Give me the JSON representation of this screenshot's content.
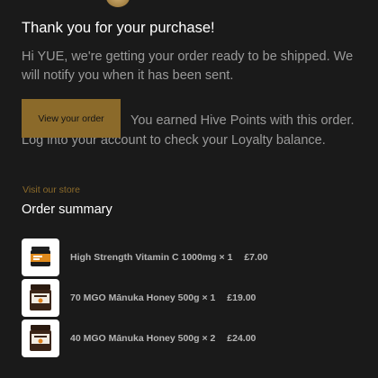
{
  "email": {
    "heading": "Thank you for your purchase!",
    "greeting": "Hi YUE, we're getting your order ready to be shipped. We will notify you when it has been sent.",
    "view_order_button": "View your order",
    "points_message": "You earned Hive Points with this order. Log into your account to check your Loyalty balance.",
    "visit_store_link": "Visit our store",
    "order_summary_title": "Order summary"
  },
  "items": [
    {
      "name": "High Strength Vitamin C 1000mg",
      "qty": "× 1",
      "price": "£7.00",
      "image_icon": "vitamin-c-jar-icon"
    },
    {
      "name": "70 MGO Mānuka Honey 500g",
      "qty": "× 1",
      "price": "£19.00",
      "image_icon": "honey-jar-icon"
    },
    {
      "name": "40 MGO Mānuka Honey 500g",
      "qty": "× 2",
      "price": "£24.00",
      "image_icon": "honey-jar-icon"
    }
  ],
  "colors": {
    "background": "#1a1a1a",
    "accent_gold": "#8b6a2a",
    "muted_text": "#9a9a9a"
  }
}
